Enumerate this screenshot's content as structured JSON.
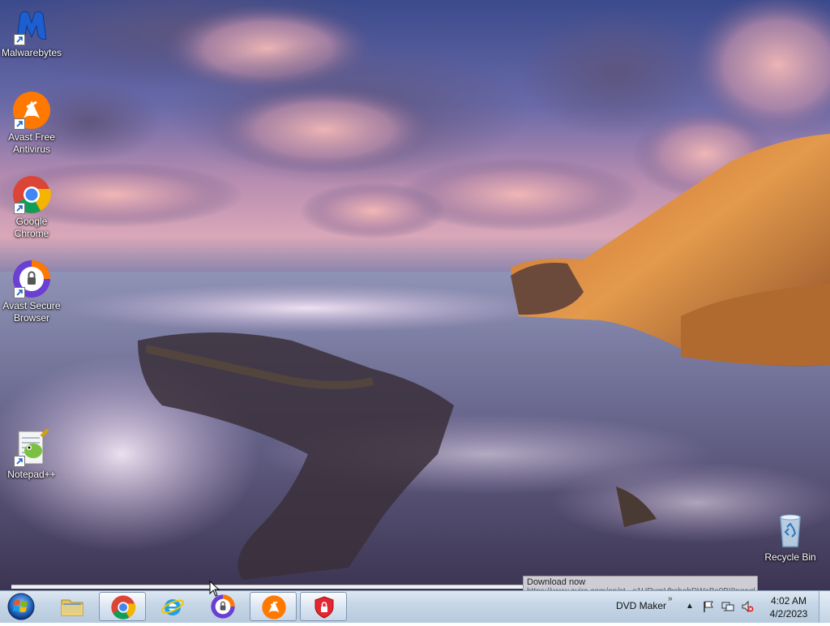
{
  "desktop": {
    "icons": [
      {
        "label": "Malwarebytes",
        "icon": "malwarebytes-icon"
      },
      {
        "label": "Avast Free Antivirus",
        "icon": "avast-icon"
      },
      {
        "label": "Google Chrome",
        "icon": "chrome-icon"
      },
      {
        "label": "Avast Secure Browser",
        "icon": "avast-secure-browser-icon"
      },
      {
        "label": "Notepad++",
        "icon": "notepad-plus-plus-icon"
      },
      {
        "label": "Recycle Bin",
        "icon": "recycle-bin-icon"
      }
    ]
  },
  "download_tooltip": {
    "title": "Download now",
    "url": "https://www.avira.com/en/st...o1URxmVbshabDWeBs0BI8nqaql"
  },
  "taskbar": {
    "pinned": [
      {
        "icon": "file-explorer-icon",
        "active": false
      },
      {
        "icon": "chrome-icon",
        "active": true
      },
      {
        "icon": "internet-explorer-icon",
        "active": false
      },
      {
        "icon": "avast-secure-browser-icon",
        "active": false
      },
      {
        "icon": "avast-icon",
        "active": true
      },
      {
        "icon": "avast-secureline-vpn-icon",
        "active": true
      }
    ],
    "toolbar_label": "DVD Maker",
    "toolbar_chevron": "»",
    "tray_expand": "▲",
    "tray_icons": [
      "action-center-flag-icon",
      "network-icon",
      "volume-muted-icon"
    ],
    "clock": {
      "time": "4:02 AM",
      "date": "4/2/2023"
    }
  },
  "colors": {
    "taskbar_top": "#dce7f2",
    "taskbar_bottom": "#b7c9dd",
    "avast_orange": "#ff7800",
    "malwarebytes_blue": "#1d5fd0"
  }
}
